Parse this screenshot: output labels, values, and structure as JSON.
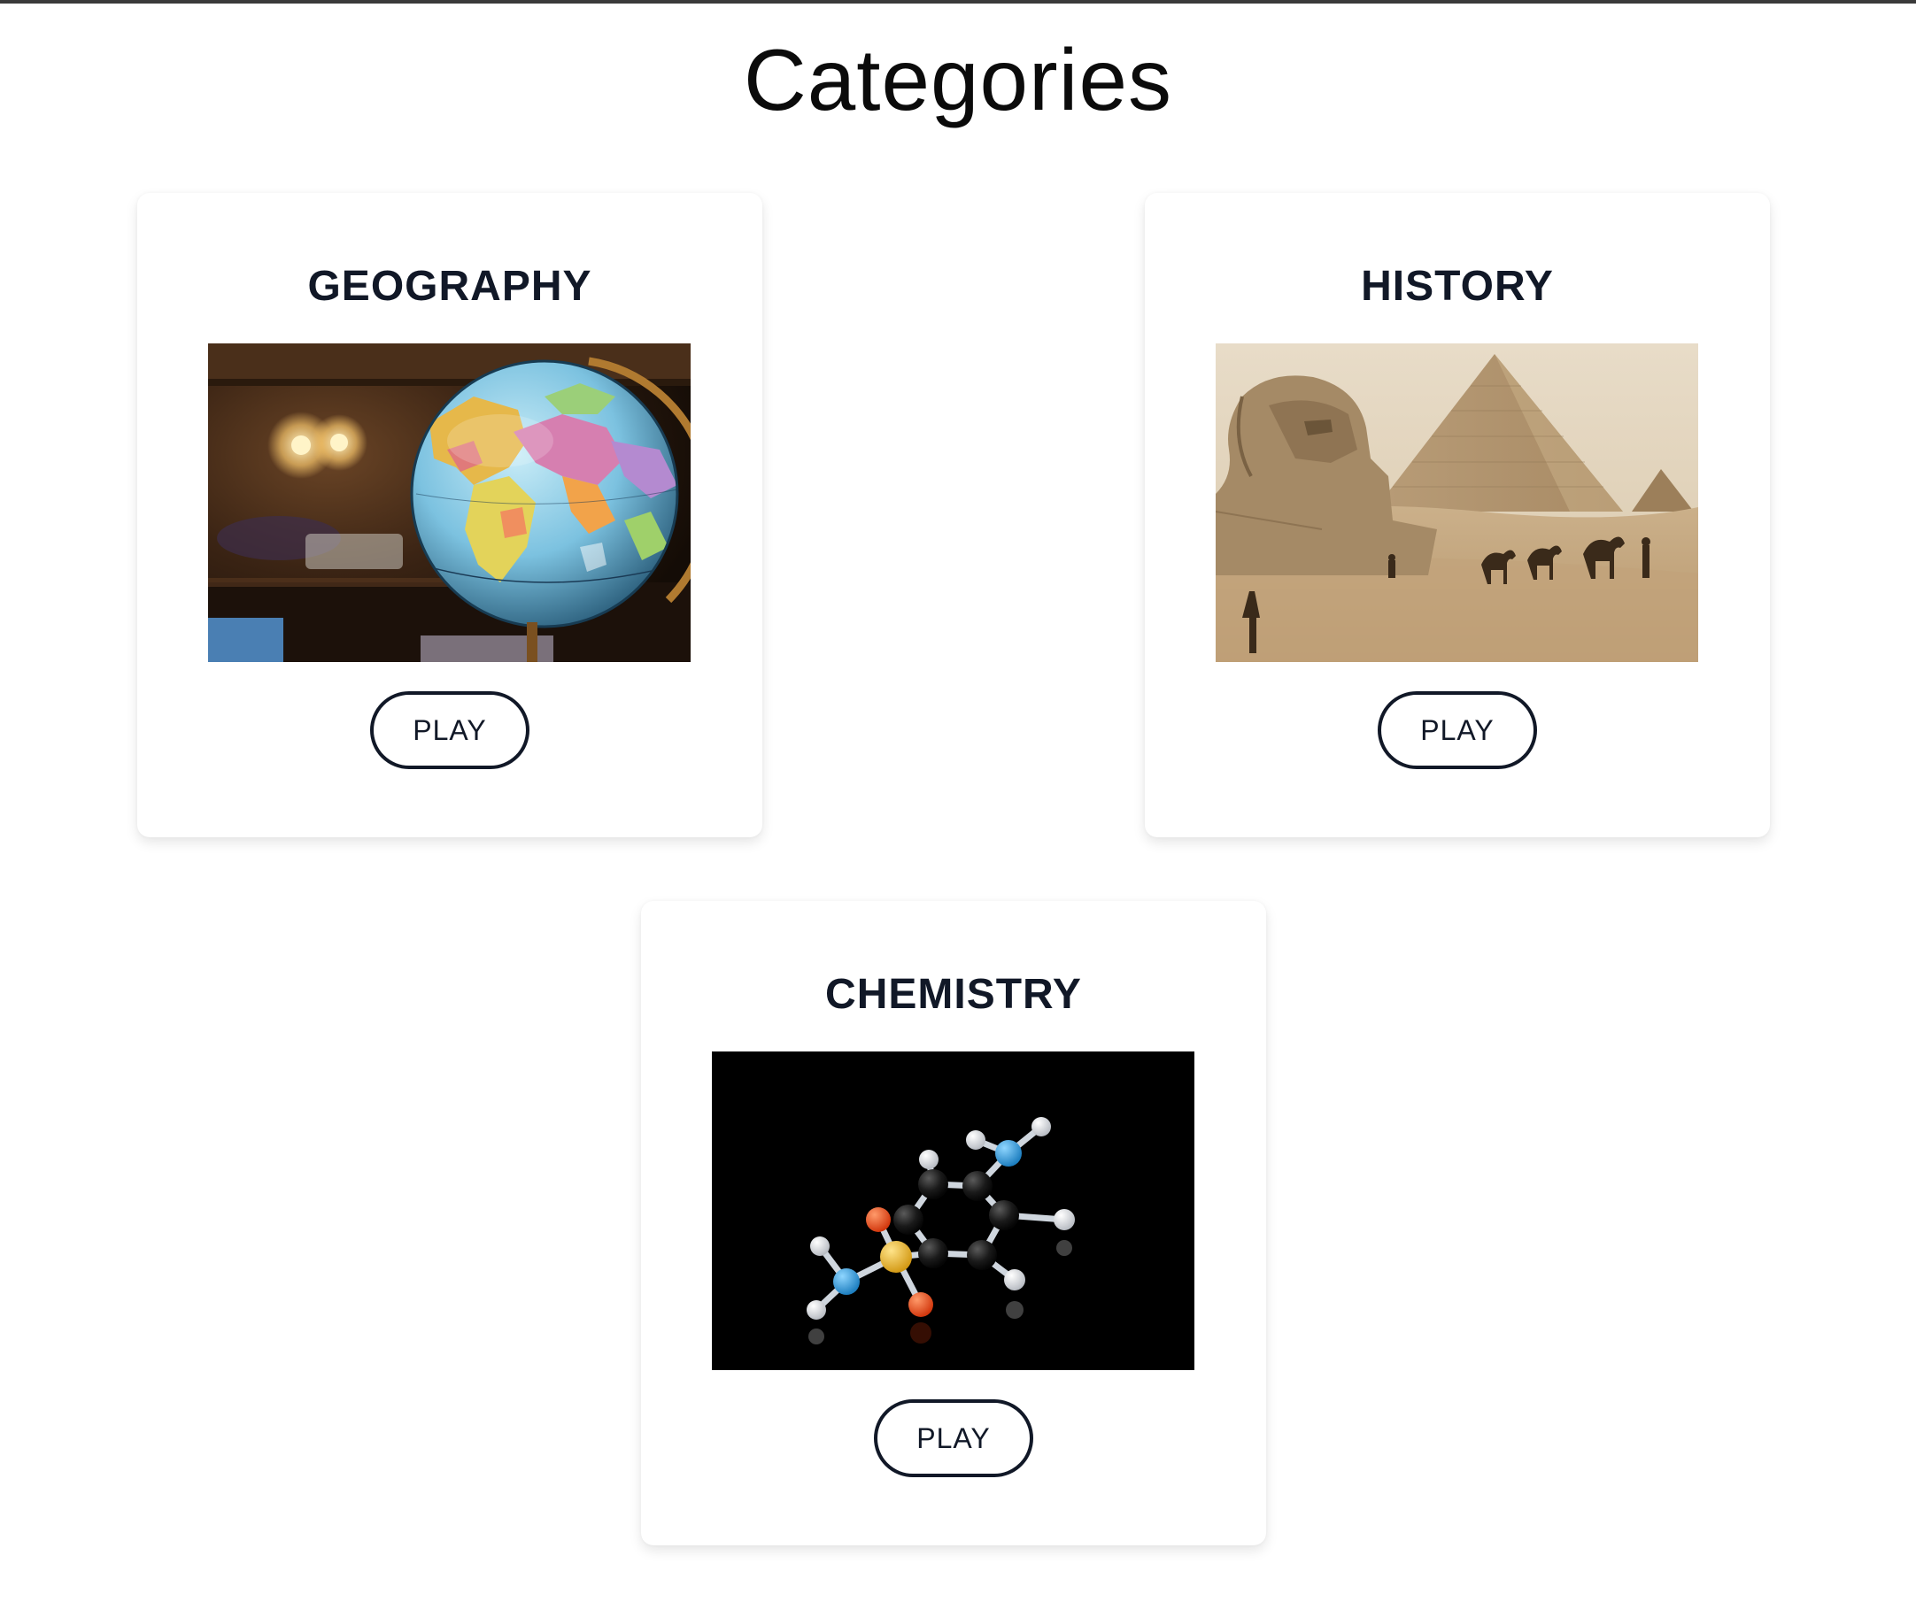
{
  "page": {
    "title": "Categories"
  },
  "categories": [
    {
      "name": "GEOGRAPHY",
      "play_label": "PLAY",
      "image_icon": "globe-photo"
    },
    {
      "name": "HISTORY",
      "play_label": "PLAY",
      "image_icon": "sphinx-pyramid-photo"
    },
    {
      "name": "CHEMISTRY",
      "play_label": "PLAY",
      "image_icon": "molecule-model-photo"
    }
  ],
  "colors": {
    "title_text": "#0b0b0b",
    "card_title_text": "#111827",
    "button_border": "#111827",
    "background": "#ffffff"
  }
}
